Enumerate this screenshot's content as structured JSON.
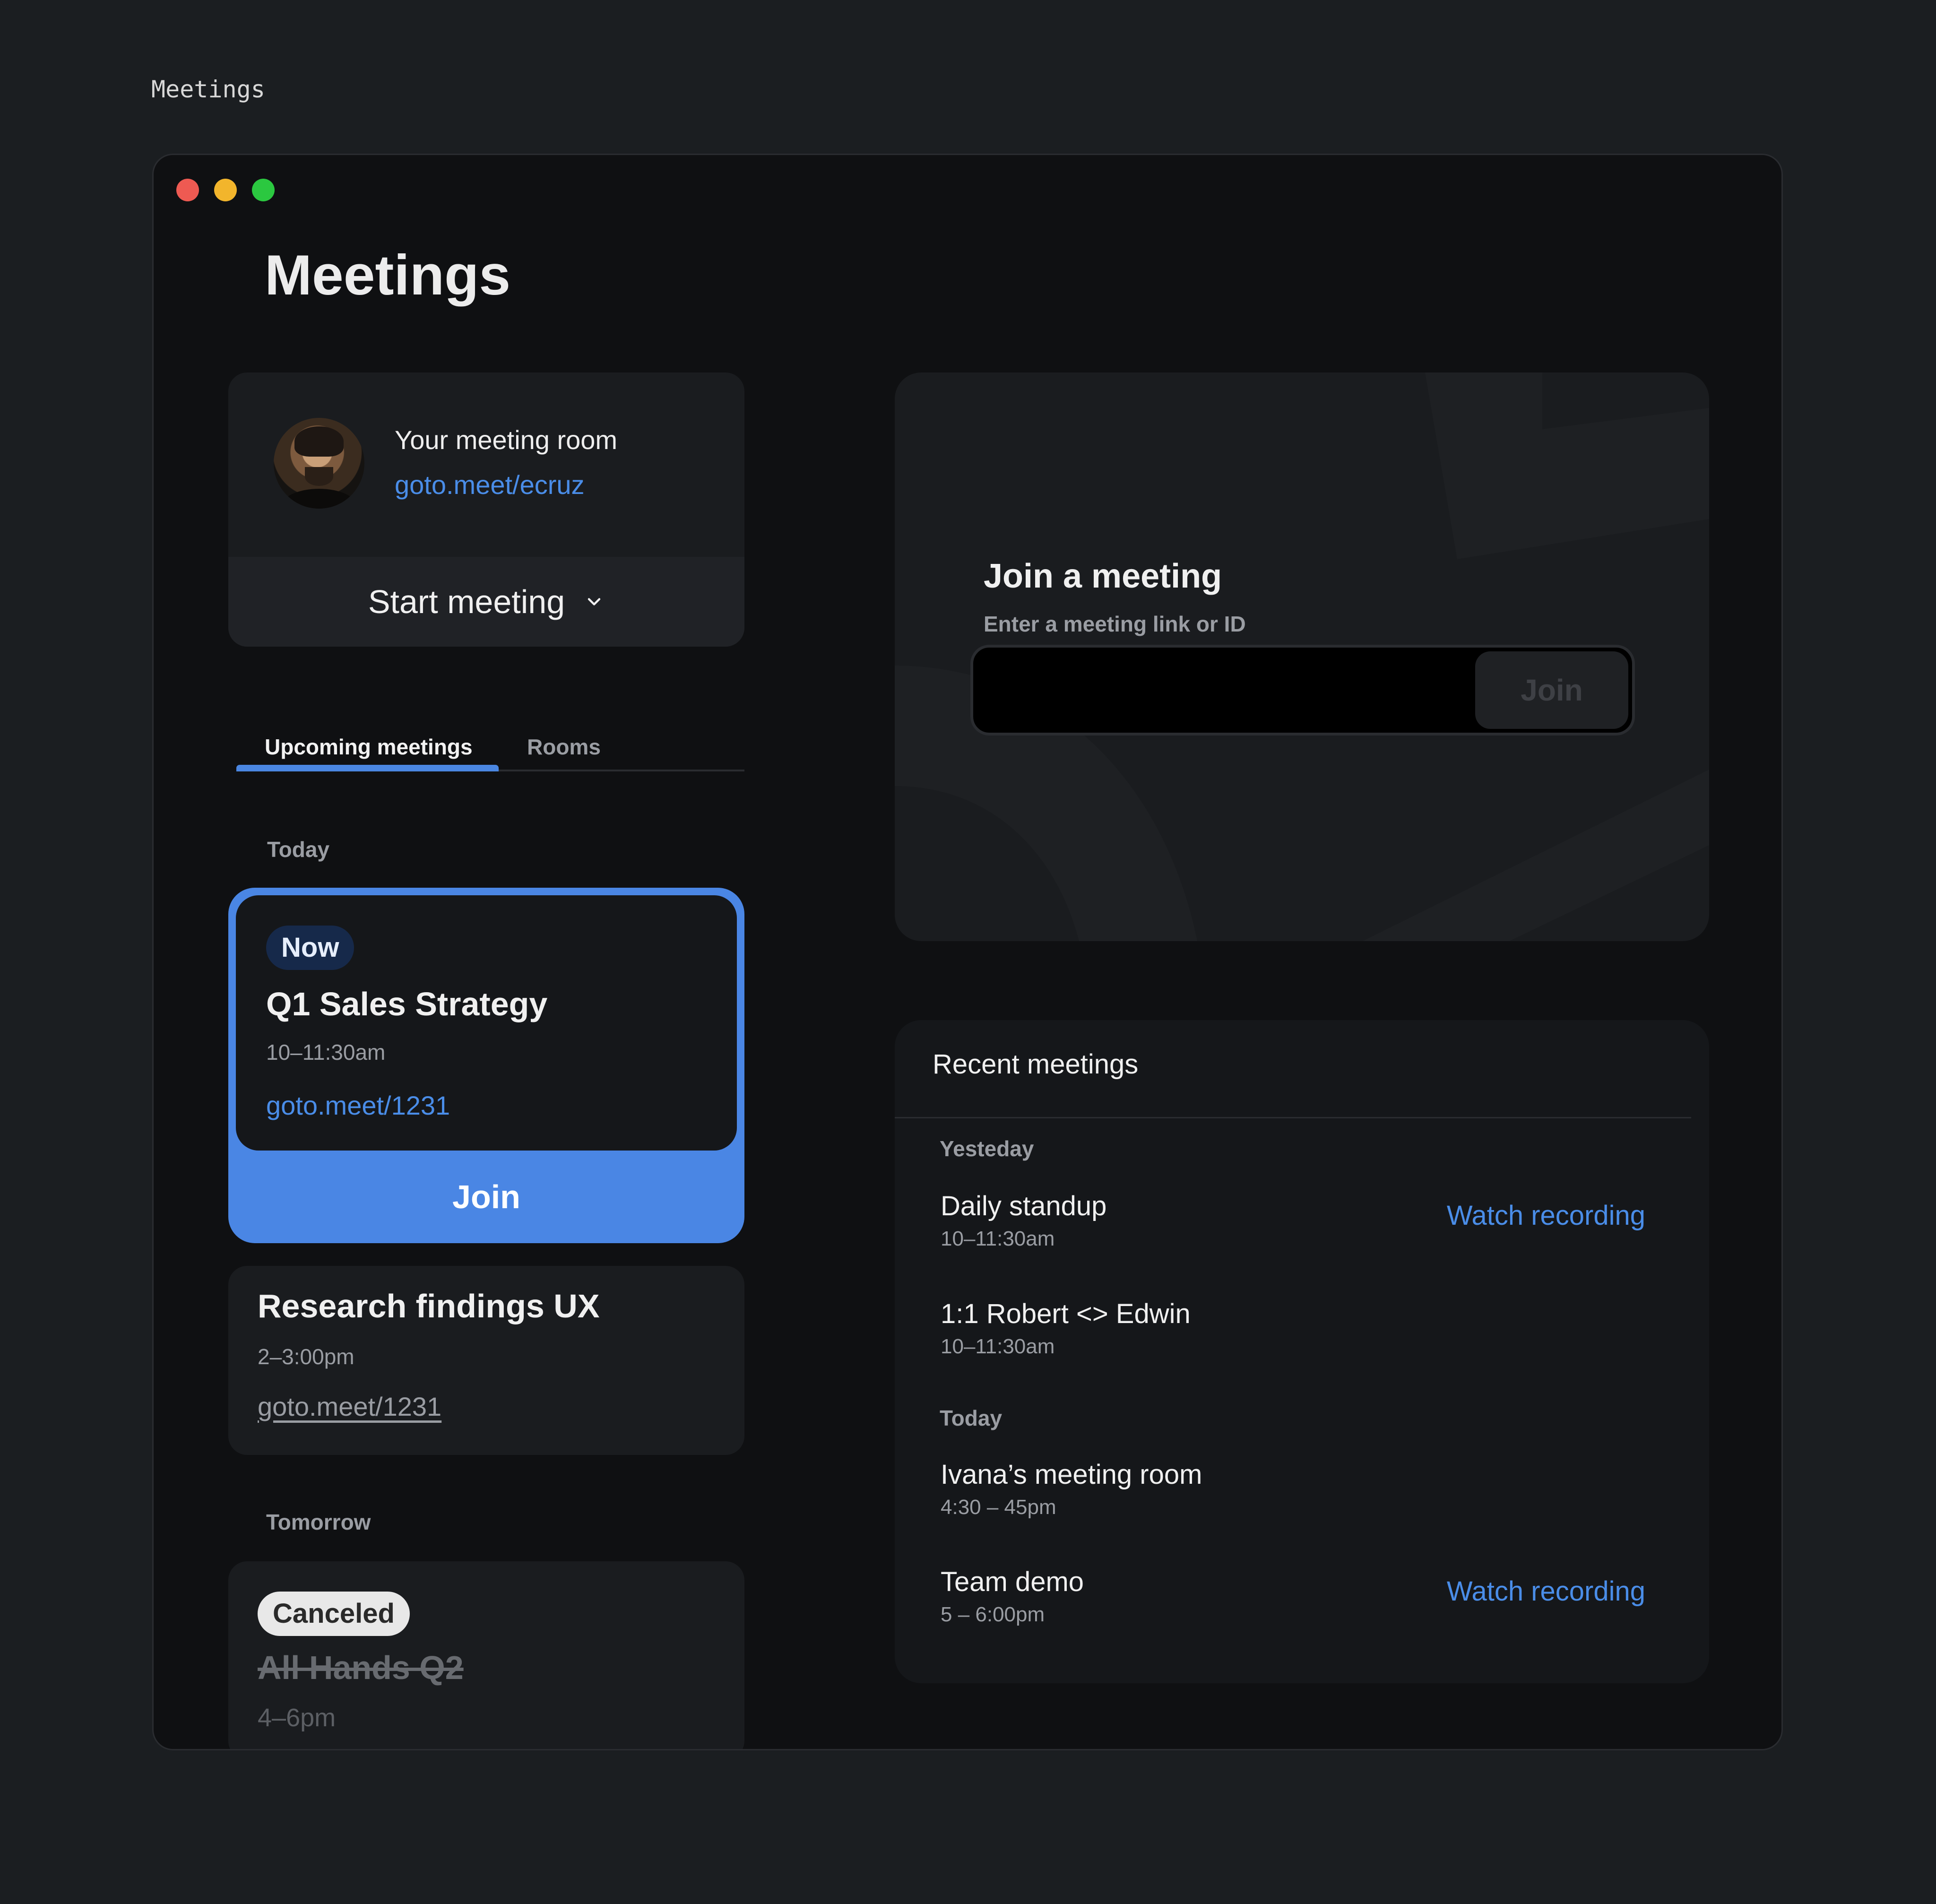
{
  "page_label": "Meetings",
  "window": {
    "title": "Meetings",
    "traffic_lights": [
      "close-dot",
      "minimize-dot",
      "maximize-dot"
    ]
  },
  "room_card": {
    "label": "Your meeting room",
    "link": "goto.meet/ecruz",
    "start_label": "Start meeting",
    "start_icon": "chevron-down-icon"
  },
  "tabs": [
    {
      "label": "Upcoming meetings",
      "active": true
    },
    {
      "label": "Rooms",
      "active": false
    }
  ],
  "upcoming": {
    "today_label": "Today",
    "tomorrow_label": "Tomorrow",
    "active_meeting": {
      "badge": "Now",
      "title": "Q1 Sales Strategy",
      "time": "10–11:30am",
      "link": "goto.meet/1231",
      "join_label": "Join"
    },
    "second_meeting": {
      "title": "Research findings UX",
      "time": "2–3:00pm",
      "link": "goto.meet/1231"
    },
    "canceled_meeting": {
      "badge": "Canceled",
      "title": "All Hands Q2",
      "time": "4–6pm"
    }
  },
  "join_panel": {
    "title": "Join a meeting",
    "subtitle": "Enter a meeting link or ID",
    "input_value": "",
    "button_label": "Join"
  },
  "recent": {
    "header": "Recent meetings",
    "group_yesterday": "Yesteday",
    "group_today": "Today",
    "items": [
      {
        "title": "Daily standup",
        "time": "10–11:30am",
        "action": "Watch recording"
      },
      {
        "title": "1:1 Robert <> Edwin",
        "time": "10–11:30am",
        "action": ""
      },
      {
        "title": "Ivana’s meeting room",
        "time": "4:30 – 45pm",
        "action": ""
      },
      {
        "title": "Team demo",
        "time": "5 – 6:00pm",
        "action": "Watch recording"
      }
    ]
  },
  "colors": {
    "accent": "#4a86e4",
    "link": "#4a8de8",
    "background": "#1b1e21",
    "window": "#0f1012",
    "card": "#1a1c1f"
  }
}
